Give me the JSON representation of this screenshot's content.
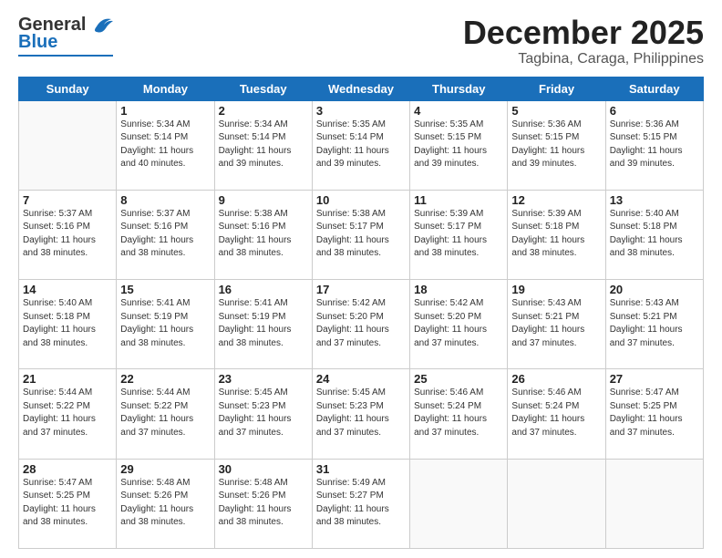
{
  "header": {
    "logo_top": "General",
    "logo_bottom": "Blue",
    "month": "December 2025",
    "location": "Tagbina, Caraga, Philippines"
  },
  "weekdays": [
    "Sunday",
    "Monday",
    "Tuesday",
    "Wednesday",
    "Thursday",
    "Friday",
    "Saturday"
  ],
  "weeks": [
    [
      {
        "day": "",
        "sunrise": "",
        "sunset": "",
        "daylight": ""
      },
      {
        "day": "1",
        "sunrise": "Sunrise: 5:34 AM",
        "sunset": "Sunset: 5:14 PM",
        "daylight": "Daylight: 11 hours and 40 minutes."
      },
      {
        "day": "2",
        "sunrise": "Sunrise: 5:34 AM",
        "sunset": "Sunset: 5:14 PM",
        "daylight": "Daylight: 11 hours and 39 minutes."
      },
      {
        "day": "3",
        "sunrise": "Sunrise: 5:35 AM",
        "sunset": "Sunset: 5:14 PM",
        "daylight": "Daylight: 11 hours and 39 minutes."
      },
      {
        "day": "4",
        "sunrise": "Sunrise: 5:35 AM",
        "sunset": "Sunset: 5:15 PM",
        "daylight": "Daylight: 11 hours and 39 minutes."
      },
      {
        "day": "5",
        "sunrise": "Sunrise: 5:36 AM",
        "sunset": "Sunset: 5:15 PM",
        "daylight": "Daylight: 11 hours and 39 minutes."
      },
      {
        "day": "6",
        "sunrise": "Sunrise: 5:36 AM",
        "sunset": "Sunset: 5:15 PM",
        "daylight": "Daylight: 11 hours and 39 minutes."
      }
    ],
    [
      {
        "day": "7",
        "sunrise": "Sunrise: 5:37 AM",
        "sunset": "Sunset: 5:16 PM",
        "daylight": "Daylight: 11 hours and 38 minutes."
      },
      {
        "day": "8",
        "sunrise": "Sunrise: 5:37 AM",
        "sunset": "Sunset: 5:16 PM",
        "daylight": "Daylight: 11 hours and 38 minutes."
      },
      {
        "day": "9",
        "sunrise": "Sunrise: 5:38 AM",
        "sunset": "Sunset: 5:16 PM",
        "daylight": "Daylight: 11 hours and 38 minutes."
      },
      {
        "day": "10",
        "sunrise": "Sunrise: 5:38 AM",
        "sunset": "Sunset: 5:17 PM",
        "daylight": "Daylight: 11 hours and 38 minutes."
      },
      {
        "day": "11",
        "sunrise": "Sunrise: 5:39 AM",
        "sunset": "Sunset: 5:17 PM",
        "daylight": "Daylight: 11 hours and 38 minutes."
      },
      {
        "day": "12",
        "sunrise": "Sunrise: 5:39 AM",
        "sunset": "Sunset: 5:18 PM",
        "daylight": "Daylight: 11 hours and 38 minutes."
      },
      {
        "day": "13",
        "sunrise": "Sunrise: 5:40 AM",
        "sunset": "Sunset: 5:18 PM",
        "daylight": "Daylight: 11 hours and 38 minutes."
      }
    ],
    [
      {
        "day": "14",
        "sunrise": "Sunrise: 5:40 AM",
        "sunset": "Sunset: 5:18 PM",
        "daylight": "Daylight: 11 hours and 38 minutes."
      },
      {
        "day": "15",
        "sunrise": "Sunrise: 5:41 AM",
        "sunset": "Sunset: 5:19 PM",
        "daylight": "Daylight: 11 hours and 38 minutes."
      },
      {
        "day": "16",
        "sunrise": "Sunrise: 5:41 AM",
        "sunset": "Sunset: 5:19 PM",
        "daylight": "Daylight: 11 hours and 38 minutes."
      },
      {
        "day": "17",
        "sunrise": "Sunrise: 5:42 AM",
        "sunset": "Sunset: 5:20 PM",
        "daylight": "Daylight: 11 hours and 37 minutes."
      },
      {
        "day": "18",
        "sunrise": "Sunrise: 5:42 AM",
        "sunset": "Sunset: 5:20 PM",
        "daylight": "Daylight: 11 hours and 37 minutes."
      },
      {
        "day": "19",
        "sunrise": "Sunrise: 5:43 AM",
        "sunset": "Sunset: 5:21 PM",
        "daylight": "Daylight: 11 hours and 37 minutes."
      },
      {
        "day": "20",
        "sunrise": "Sunrise: 5:43 AM",
        "sunset": "Sunset: 5:21 PM",
        "daylight": "Daylight: 11 hours and 37 minutes."
      }
    ],
    [
      {
        "day": "21",
        "sunrise": "Sunrise: 5:44 AM",
        "sunset": "Sunset: 5:22 PM",
        "daylight": "Daylight: 11 hours and 37 minutes."
      },
      {
        "day": "22",
        "sunrise": "Sunrise: 5:44 AM",
        "sunset": "Sunset: 5:22 PM",
        "daylight": "Daylight: 11 hours and 37 minutes."
      },
      {
        "day": "23",
        "sunrise": "Sunrise: 5:45 AM",
        "sunset": "Sunset: 5:23 PM",
        "daylight": "Daylight: 11 hours and 37 minutes."
      },
      {
        "day": "24",
        "sunrise": "Sunrise: 5:45 AM",
        "sunset": "Sunset: 5:23 PM",
        "daylight": "Daylight: 11 hours and 37 minutes."
      },
      {
        "day": "25",
        "sunrise": "Sunrise: 5:46 AM",
        "sunset": "Sunset: 5:24 PM",
        "daylight": "Daylight: 11 hours and 37 minutes."
      },
      {
        "day": "26",
        "sunrise": "Sunrise: 5:46 AM",
        "sunset": "Sunset: 5:24 PM",
        "daylight": "Daylight: 11 hours and 37 minutes."
      },
      {
        "day": "27",
        "sunrise": "Sunrise: 5:47 AM",
        "sunset": "Sunset: 5:25 PM",
        "daylight": "Daylight: 11 hours and 37 minutes."
      }
    ],
    [
      {
        "day": "28",
        "sunrise": "Sunrise: 5:47 AM",
        "sunset": "Sunset: 5:25 PM",
        "daylight": "Daylight: 11 hours and 38 minutes."
      },
      {
        "day": "29",
        "sunrise": "Sunrise: 5:48 AM",
        "sunset": "Sunset: 5:26 PM",
        "daylight": "Daylight: 11 hours and 38 minutes."
      },
      {
        "day": "30",
        "sunrise": "Sunrise: 5:48 AM",
        "sunset": "Sunset: 5:26 PM",
        "daylight": "Daylight: 11 hours and 38 minutes."
      },
      {
        "day": "31",
        "sunrise": "Sunrise: 5:49 AM",
        "sunset": "Sunset: 5:27 PM",
        "daylight": "Daylight: 11 hours and 38 minutes."
      },
      {
        "day": "",
        "sunrise": "",
        "sunset": "",
        "daylight": ""
      },
      {
        "day": "",
        "sunrise": "",
        "sunset": "",
        "daylight": ""
      },
      {
        "day": "",
        "sunrise": "",
        "sunset": "",
        "daylight": ""
      }
    ]
  ]
}
